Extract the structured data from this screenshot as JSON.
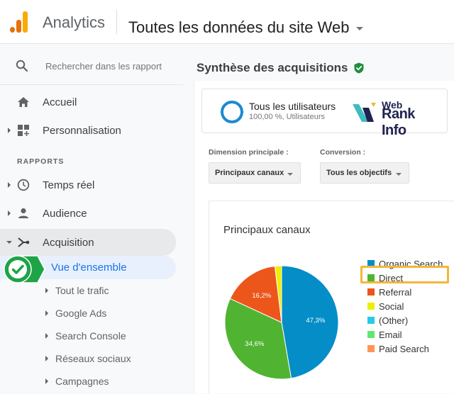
{
  "header": {
    "app_name": "Analytics",
    "property_selector": "Toutes les données du site Web"
  },
  "sidebar": {
    "search_placeholder": "Rechercher dans les rapport",
    "top_items": [
      {
        "label": "Accueil",
        "icon": "home-icon"
      },
      {
        "label": "Personnalisation",
        "icon": "customization-icon"
      }
    ],
    "section_label": "RAPPORTS",
    "report_items": [
      {
        "label": "Temps réel",
        "icon": "clock-icon"
      },
      {
        "label": "Audience",
        "icon": "person-icon"
      },
      {
        "label": "Acquisition",
        "icon": "acquisition-icon",
        "expanded": true
      }
    ],
    "active_item": "Vue d'ensemble",
    "sub_items": [
      "Tout le trafic",
      "Google Ads",
      "Search Console",
      "Réseaux sociaux",
      "Campagnes"
    ]
  },
  "main": {
    "title": "Synthèse des acquisitions",
    "segment": {
      "name": "Tous les utilisateurs",
      "detail": "100,00 %, Utilisateurs"
    },
    "watermark": {
      "line1": "Web",
      "line2": "Rank Info"
    },
    "dimension": {
      "label": "Dimension principale :",
      "value": "Principaux canaux"
    },
    "conversion": {
      "label": "Conversion :",
      "value": "Tous les objectifs"
    }
  },
  "colors": {
    "accent_blue": "#1a73e8",
    "check_green": "#1ea446",
    "highlight": "#f3b63a"
  },
  "chart_data": {
    "type": "pie",
    "title": "Principaux canaux",
    "legend_position": "right",
    "highlighted": "Direct",
    "slices": [
      {
        "label": "Organic Search",
        "value": 47.3,
        "display": "47,3%",
        "color": "#058dc7"
      },
      {
        "label": "Direct",
        "value": 34.6,
        "display": "34,6%",
        "color": "#50b432"
      },
      {
        "label": "Referral",
        "value": 16.2,
        "display": "16,2%",
        "color": "#ed561b"
      },
      {
        "label": "Social",
        "value": 1.9,
        "display": "",
        "color": "#edef00"
      },
      {
        "label": "(Other)",
        "value": 0,
        "display": "",
        "color": "#24cbe5"
      },
      {
        "label": "Email",
        "value": 0,
        "display": "",
        "color": "#64e572"
      },
      {
        "label": "Paid Search",
        "value": 0,
        "display": "",
        "color": "#ff9655"
      }
    ]
  }
}
